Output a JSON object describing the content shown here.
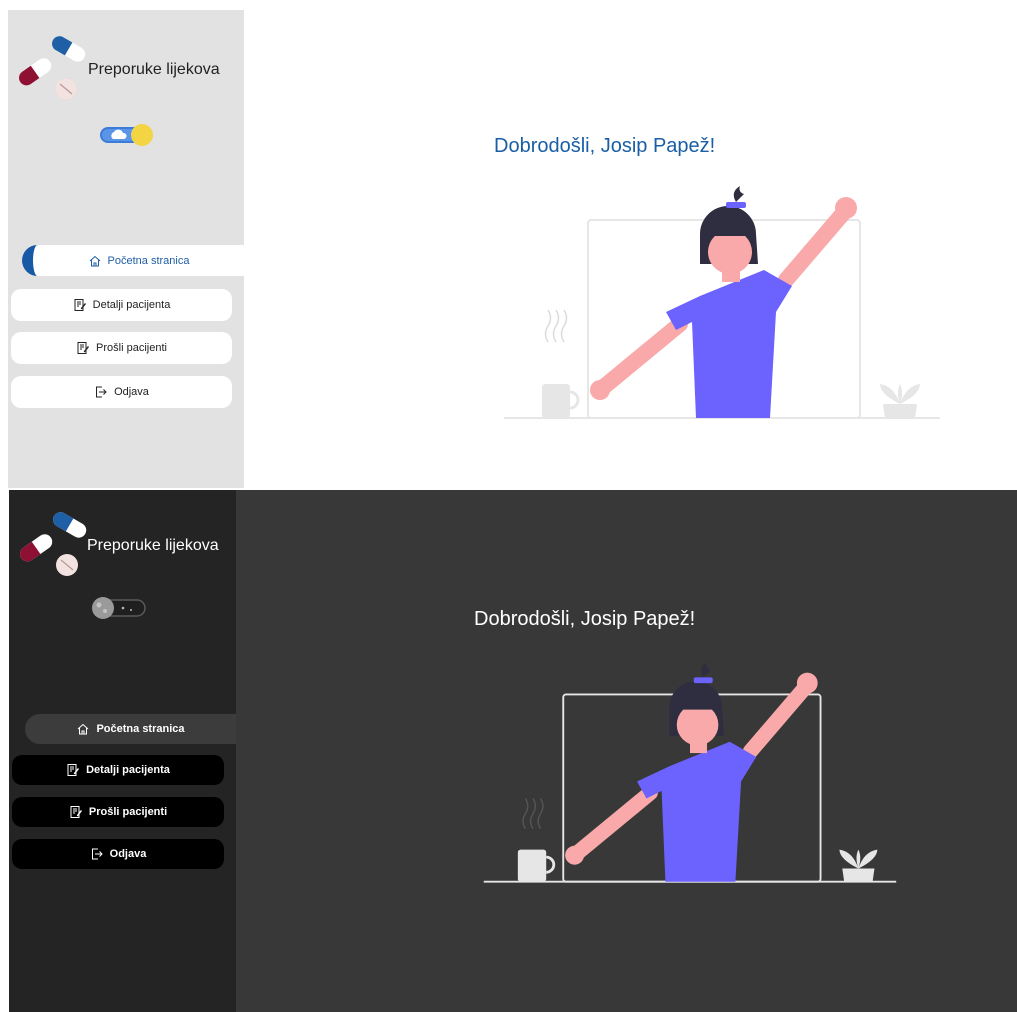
{
  "light": {
    "app_title": "Preporuke lijekova",
    "theme_toggle_state": "light",
    "nav": [
      {
        "label": "Početna stranica",
        "icon": "home-icon",
        "active": true
      },
      {
        "label": "Detalji pacijenta",
        "icon": "edit-document-icon",
        "active": false
      },
      {
        "label": "Prošli pacijenti",
        "icon": "edit-document-icon",
        "active": false
      },
      {
        "label": "Odjava",
        "icon": "logout-icon",
        "active": false
      }
    ],
    "welcome": "Dobrodošli, Josip Papež!"
  },
  "dark": {
    "app_title": "Preporuke lijekova",
    "theme_toggle_state": "dark",
    "nav": [
      {
        "label": "Početna stranica",
        "icon": "home-icon",
        "active": true
      },
      {
        "label": "Detalji pacijenta",
        "icon": "edit-document-icon",
        "active": false
      },
      {
        "label": "Prošli pacijenti",
        "icon": "edit-document-icon",
        "active": false
      },
      {
        "label": "Odjava",
        "icon": "logout-icon",
        "active": false
      }
    ],
    "welcome": "Dobrodošli, Josip Papež!"
  },
  "colors": {
    "accent_blue": "#1859a5",
    "sidebar_light": "#e2e2e2",
    "sidebar_dark": "#242424",
    "main_dark": "#383838",
    "illustration_purple": "#6c63ff",
    "skin": "#f9a9a9"
  }
}
